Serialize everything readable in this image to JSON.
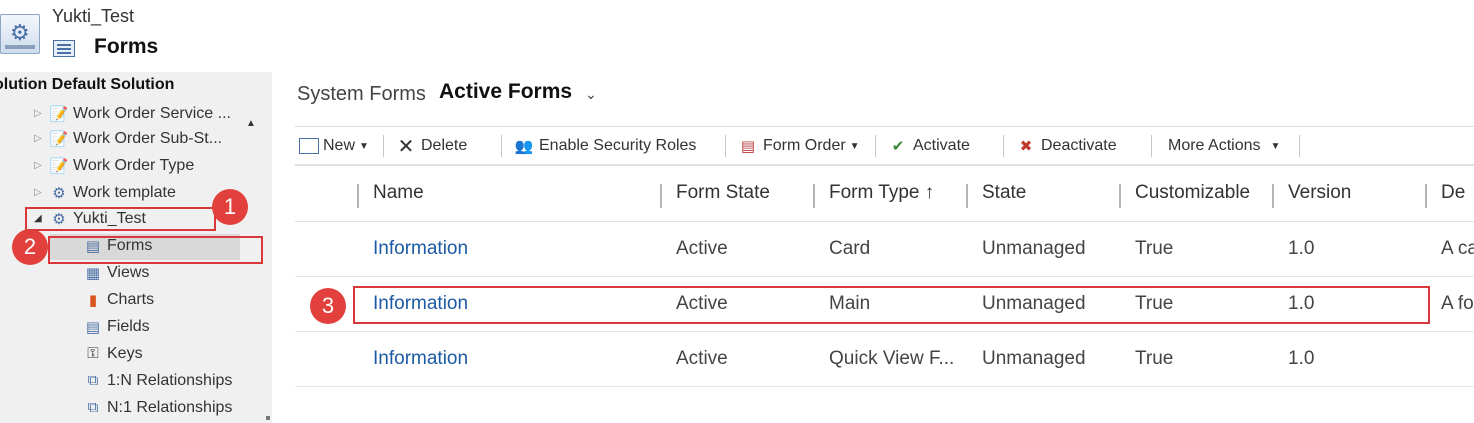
{
  "header": {
    "app_name": "Yukti_Test",
    "page_title": "Forms"
  },
  "sidebar": {
    "solution_title": "olution Default Solution",
    "items": [
      {
        "label": "Work Order Service ...",
        "icon": "form-icon",
        "expanded": false
      },
      {
        "label": "Work Order Sub-St...",
        "icon": "form-icon",
        "expanded": false
      },
      {
        "label": "Work Order Type",
        "icon": "form-icon",
        "expanded": false
      },
      {
        "label": "Work template",
        "icon": "entity-gear-icon",
        "expanded": false
      },
      {
        "label": "Yukti_Test",
        "icon": "entity-gear-icon",
        "expanded": true
      }
    ],
    "children": [
      {
        "label": "Forms",
        "icon": "forms-icon",
        "selected": true
      },
      {
        "label": "Views",
        "icon": "views-icon"
      },
      {
        "label": "Charts",
        "icon": "charts-icon"
      },
      {
        "label": "Fields",
        "icon": "fields-icon"
      },
      {
        "label": "Keys",
        "icon": "keys-icon"
      },
      {
        "label": "1:N Relationships",
        "icon": "relationship-icon"
      },
      {
        "label": "N:1 Relationships",
        "icon": "relationship-icon"
      }
    ]
  },
  "view": {
    "label": "System Forms",
    "name": "Active Forms"
  },
  "toolbar": {
    "new": "New",
    "delete": "Delete",
    "security": "Enable Security Roles",
    "form_order": "Form Order",
    "activate": "Activate",
    "deactivate": "Deactivate",
    "more": "More Actions"
  },
  "grid": {
    "columns": [
      "Name",
      "Form State",
      "Form Type ↑",
      "State",
      "Customizable",
      "Version",
      "De"
    ],
    "rows": [
      [
        "Information",
        "Active",
        "Card",
        "Unmanaged",
        "True",
        "1.0",
        "A ca"
      ],
      [
        "Information",
        "Active",
        "Main",
        "Unmanaged",
        "True",
        "1.0",
        "A fo"
      ],
      [
        "Information",
        "Active",
        "Quick View F...",
        "Unmanaged",
        "True",
        "1.0",
        ""
      ]
    ]
  },
  "annotations": {
    "badge1": "1",
    "badge2": "2",
    "badge3": "3",
    "color": "#e2403c"
  }
}
